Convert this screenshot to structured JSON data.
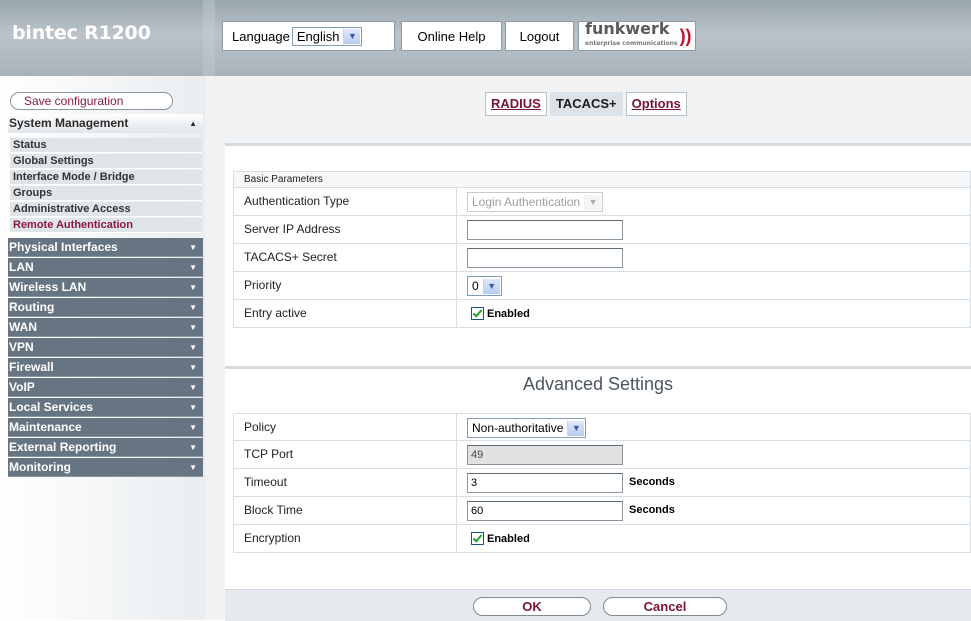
{
  "header": {
    "brand": "bintec R1200",
    "language_label": "Language",
    "language_value": "English",
    "online_help": "Online Help",
    "logout": "Logout",
    "logo_text": "funkwerk",
    "logo_subtitle": "enterprise communications"
  },
  "sidebar": {
    "save_label": "Save configuration",
    "system_management": "System Management",
    "sub_items": [
      "Status",
      "Global Settings",
      "Interface Mode / Bridge",
      "Groups",
      "Administrative Access",
      "Remote Authentication"
    ],
    "active_item": "Remote Authentication",
    "sections": [
      "Physical Interfaces",
      "LAN",
      "Wireless LAN",
      "Routing",
      "WAN",
      "VPN",
      "Firewall",
      "VoIP",
      "Local Services",
      "Maintenance",
      "External Reporting",
      "Monitoring"
    ]
  },
  "tabs": {
    "radius": "RADIUS",
    "tacacs": "TACACS+",
    "options": "Options",
    "active": "TACACS+"
  },
  "basic": {
    "section_title": "Basic Parameters",
    "auth_type_label": "Authentication Type",
    "auth_type_value": "Login Authentication",
    "server_ip_label": "Server IP Address",
    "server_ip_value": "",
    "secret_label": "TACACS+ Secret",
    "secret_value": "",
    "priority_label": "Priority",
    "priority_value": "0",
    "entry_active_label": "Entry active",
    "entry_active_check": "Enabled"
  },
  "advanced": {
    "title": "Advanced Settings",
    "policy_label": "Policy",
    "policy_value": "Non-authoritative",
    "tcp_port_label": "TCP Port",
    "tcp_port_value": "49",
    "timeout_label": "Timeout",
    "timeout_value": "3",
    "timeout_unit": "Seconds",
    "block_time_label": "Block Time",
    "block_time_value": "60",
    "block_time_unit": "Seconds",
    "encryption_label": "Encryption",
    "encryption_check": "Enabled"
  },
  "buttons": {
    "ok": "OK",
    "cancel": "Cancel"
  },
  "colors": {
    "accent": "#7a1335",
    "nav_closed_bg": "#667581",
    "header_bg": "#a8b2b8"
  }
}
